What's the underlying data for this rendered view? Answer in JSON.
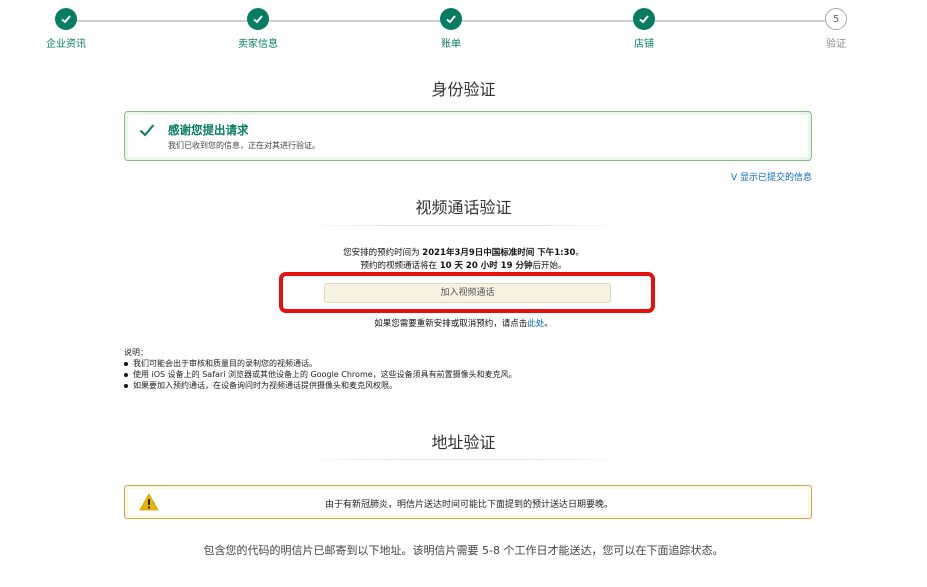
{
  "stepper": {
    "steps": [
      {
        "label": "企业资讯",
        "state": "done"
      },
      {
        "label": "卖家信息",
        "state": "done"
      },
      {
        "label": "账单",
        "state": "done"
      },
      {
        "label": "店铺",
        "state": "done"
      },
      {
        "label": "验证",
        "state": "pending",
        "number": "5"
      }
    ]
  },
  "identity": {
    "title": "身份验证",
    "success_title": "感谢您提出请求",
    "success_desc": "我们已收到您的信息，正在对其进行验证。",
    "show_submitted": "V 显示已提交的信息"
  },
  "video": {
    "title": "视频通话验证",
    "appt_prefix": "您安排的预约时间为 ",
    "appt_time": "2021年3月9日中国标准时间 下午1:30",
    "appt_suffix": "。",
    "countdown_prefix": "预约的视频通话将在 ",
    "countdown_value": "10 天 20 小时 19 分钟",
    "countdown_suffix": "后开始。",
    "join_button": "加入视频通话",
    "resched_prefix": "如果您需要重新安排或取消预约，请点击",
    "resched_link": "此处",
    "resched_suffix": "。"
  },
  "notes": {
    "heading": "说明：",
    "items": [
      "我们可能会出于审核和质量目的录制您的视频通话。",
      "使用 iOS 设备上的 Safari 浏览器或其他设备上的 Google Chrome，这些设备须具有前置摄像头和麦克风。",
      "如果要加入预约通话，在设备询问时为视频通话提供摄像头和麦克风权限。"
    ]
  },
  "address": {
    "title": "地址验证",
    "warning": "由于有新冠肺炎，明信片送达时间可能比下面提到的预计送达日期要晚。",
    "postcard_info": "包含您的代码的明信片已邮寄到以下地址。该明信片需要 5-8 个工作日才能送达，您可以在下面追踪状态。"
  },
  "colors": {
    "success_green": "#067d62",
    "link_blue": "#0066c0",
    "highlight_red": "#e8100d",
    "warning_yellow": "#e9b500"
  }
}
